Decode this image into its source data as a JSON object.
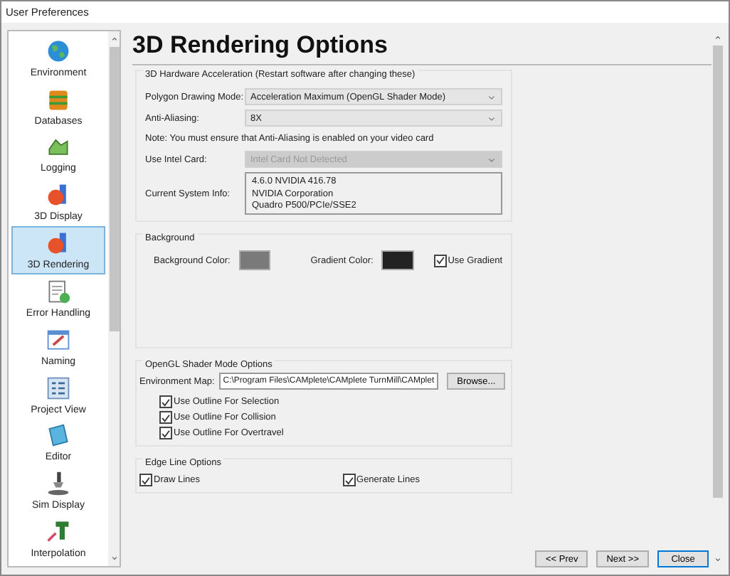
{
  "window": {
    "title": "User Preferences"
  },
  "sidebar": {
    "items": [
      {
        "label": "Environment",
        "selected": false
      },
      {
        "label": "Databases",
        "selected": false
      },
      {
        "label": "Logging",
        "selected": false
      },
      {
        "label": "3D Display",
        "selected": false
      },
      {
        "label": "3D Rendering",
        "selected": true
      },
      {
        "label": "Error Handling",
        "selected": false
      },
      {
        "label": "Naming",
        "selected": false
      },
      {
        "label": "Project View",
        "selected": false
      },
      {
        "label": "Editor",
        "selected": false
      },
      {
        "label": "Sim Display",
        "selected": false
      },
      {
        "label": "Interpolation",
        "selected": false
      }
    ]
  },
  "page_title": "3D Rendering Options",
  "hardware": {
    "title": "3D Hardware Acceleration (Restart software after changing these)",
    "polygon_mode": {
      "label": "Polygon Drawing Mode:",
      "value": "Acceleration Maximum (OpenGL Shader Mode)",
      "disabled": false
    },
    "anti_aliasing": {
      "label": "Anti-Aliasing:",
      "value": "8X",
      "disabled": false
    },
    "note": "Note: You must ensure that Anti-Aliasing is enabled on your video card",
    "intel_card": {
      "label": "Use Intel Card:",
      "value": "Intel Card Not Detected",
      "disabled": true
    },
    "system_info": {
      "label": "Current System Info:",
      "lines": [
        "4.6.0 NVIDIA 416.78",
        "NVIDIA Corporation",
        "Quadro P500/PCIe/SSE2"
      ]
    }
  },
  "background": {
    "title": "Background",
    "background_color": {
      "label": "Background Color:",
      "color": "#7a7a7a"
    },
    "gradient_color": {
      "label": "Gradient Color:",
      "color": "#222222"
    },
    "use_gradient": {
      "label": "Use Gradient",
      "checked": true
    }
  },
  "shader": {
    "title": "OpenGL Shader Mode Options",
    "environment_map": {
      "label": "Environment Map:",
      "value": "C:\\Program Files\\CAMplete\\CAMplete TurnMill\\CAMplet"
    },
    "browse_button": "Browse...",
    "options": [
      {
        "label": "Use Outline For Selection",
        "checked": true
      },
      {
        "label": "Use Outline For Collision",
        "checked": true
      },
      {
        "label": "Use Outline For Overtravel",
        "checked": true
      }
    ]
  },
  "edge_lines": {
    "title": "Edge Line Options",
    "options": [
      {
        "label": "Draw Lines",
        "checked": true
      },
      {
        "label": "Generate Lines",
        "checked": true
      }
    ]
  },
  "buttons": [
    "<< Prev",
    "Next >>",
    "Close"
  ]
}
